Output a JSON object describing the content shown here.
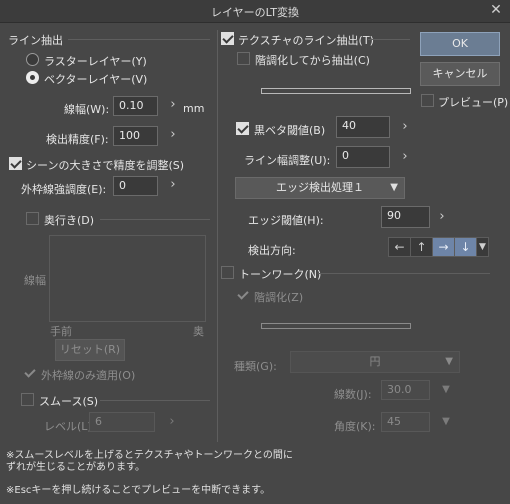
{
  "dialog": {
    "title": "レイヤーのLT変換"
  },
  "line_extract": {
    "section": "ライン抽出",
    "raster": "ラスターレイヤー(Y)",
    "vector": "ベクターレイヤー(V)",
    "line_width_label": "線幅(W):",
    "line_width_value": "0.10",
    "unit": "mm",
    "precision_label": "検出精度(F):",
    "precision_value": "100",
    "adjust_scene": "シーンの大きさで精度を調整(S)",
    "outer_line_label": "外枠線強調度(E):",
    "outer_line_value": "0"
  },
  "depth": {
    "label": "奥行き(D)",
    "axis_y": "線幅",
    "axis_near": "手前",
    "axis_far": "奥",
    "reset": "リセット(R)",
    "outer_only": "外枠線のみ適用(O)"
  },
  "smooth": {
    "label": "スムース(S)",
    "level_label": "レベル(L):",
    "level_value": "6"
  },
  "texture": {
    "label": "テクスチャのライン抽出(T)",
    "gradation": "階調化してから抽出(C)",
    "black_label": "黒ベタ閾値(B)",
    "black_value": "40",
    "line_adjust_label": "ライン幅調整(U):",
    "line_adjust_value": "0",
    "edge_process": "エッジ検出処理１",
    "edge_threshold_label": "エッジ閾値(H):",
    "edge_threshold_value": "90",
    "direction_label": "検出方向:"
  },
  "tone": {
    "label": "トーンワーク(N)",
    "gradation": "階調化(Z)",
    "type_label": "種類(G):",
    "type_value": "円",
    "lines_label": "線数(J):",
    "lines_value": "30.0",
    "angle_label": "角度(K):",
    "angle_value": "45"
  },
  "buttons": {
    "ok": "OK",
    "cancel": "キャンセル",
    "preview": "プレビュー(P)"
  },
  "notes": {
    "line1": "※スムースレベルを上げるとテクスチャやトーンワークとの間に",
    "line2": "ずれが生じることがあります。",
    "line3": "※Escキーを押し続けることでプレビューを中断できます。"
  },
  "colors": {
    "background": "#474747",
    "accent": "#6b7d93"
  }
}
